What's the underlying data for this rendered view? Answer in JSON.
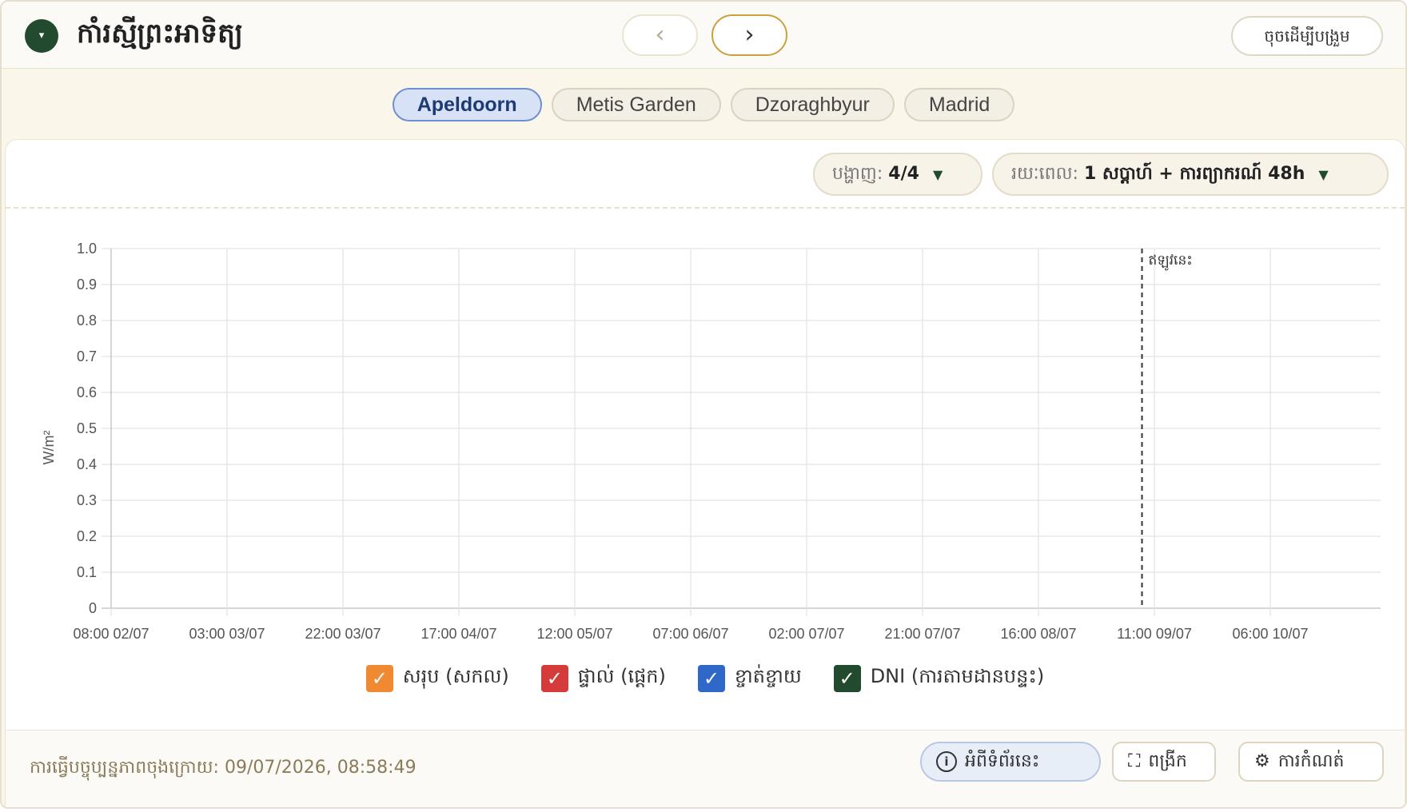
{
  "header": {
    "title": "កាំរស្មីព្រះអាទិត្យ",
    "collapse_icon": "▾",
    "prev_icon": "‹",
    "next_icon": "›",
    "expand_label": "ចុចដើម្បីបង្រួម"
  },
  "locations": {
    "tabs": [
      "Apeldoorn",
      "Metis Garden",
      "Dzoraghbyur",
      "Madrid"
    ],
    "active": "Apeldoorn"
  },
  "toolbar": {
    "show_label": "បង្ហាញ:",
    "show_value": "4/4",
    "range_label": "រយៈពេល:",
    "range_value": "1 សប្តាហ៍ + ការព្យាករណ៍ 48h",
    "caret": "▼"
  },
  "chart_data": {
    "type": "line",
    "ylabel": "W/m²",
    "ylim": [
      0,
      1.0
    ],
    "y_ticks": [
      "0",
      "0.1",
      "0.2",
      "0.3",
      "0.4",
      "0.5",
      "0.6",
      "0.7",
      "0.8",
      "0.9",
      "1.0"
    ],
    "x_ticks": [
      "08:00 02/07",
      "03:00 03/07",
      "22:00 03/07",
      "17:00 04/07",
      "12:00 05/07",
      "07:00 06/07",
      "02:00 07/07",
      "21:00 07/07",
      "16:00 08/07",
      "11:00 09/07",
      "06:00 10/07"
    ],
    "now_marker": {
      "label": "ឥឡូវនេះ",
      "x": "08:58 09/07"
    },
    "grid": true,
    "series": [
      {
        "name": "សរុប (សកល)",
        "color": "#ef8a33",
        "values": []
      },
      {
        "name": "ផ្ទាល់ (ផ្តេក)",
        "color": "#d63b3b",
        "values": []
      },
      {
        "name": "ខ្ចាត់ខ្ចាយ",
        "color": "#2f68c9",
        "values": []
      },
      {
        "name": "DNI (ការតាមដានបន្ទះ)",
        "color": "#224a2f",
        "values": []
      }
    ],
    "legend_position": "bottom"
  },
  "legend": {
    "check": "✓",
    "items": [
      {
        "label": "សរុប (សកល)",
        "color": "#ef8a33"
      },
      {
        "label": "ផ្ទាល់ (ផ្តេក)",
        "color": "#d63b3b"
      },
      {
        "label": "ខ្ចាត់ខ្ចាយ",
        "color": "#2f68c9"
      },
      {
        "label": "DNI (ការតាមដានបន្ទះ)",
        "color": "#224a2f"
      }
    ]
  },
  "footer": {
    "updated_text": "ការធ្វើបច្ចុប្បន្នភាពចុងក្រោយ: 09/07/2026, 08:58:49",
    "about_label": "អំពីទំព័រនេះ",
    "about_icon": "i",
    "fullscreen_label": "ពង្រីក",
    "fullscreen_icon": "⛶",
    "settings_label": "ការកំណត់",
    "settings_icon": "⚙"
  }
}
